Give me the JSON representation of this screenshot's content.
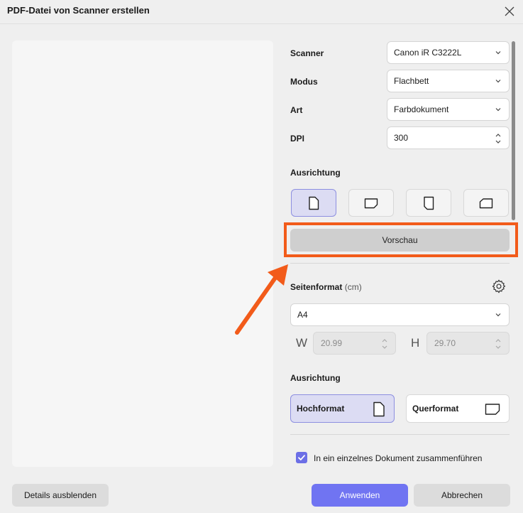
{
  "window": {
    "title": "PDF-Datei von Scanner erstellen"
  },
  "settings": {
    "scanner_label": "Scanner",
    "scanner_value": "Canon iR C3222L",
    "mode_label": "Modus",
    "mode_value": "Flachbett",
    "type_label": "Art",
    "type_value": "Farbdokument",
    "dpi_label": "DPI",
    "dpi_value": "300",
    "orientation_label": "Ausrichtung",
    "preview_label": "Vorschau"
  },
  "page_format": {
    "label": "Seitenformat",
    "unit": "(cm)",
    "size_value": "A4",
    "width_letter": "W",
    "width_value": "20.99",
    "height_letter": "H",
    "height_value": "29.70",
    "orientation_label": "Ausrichtung",
    "portrait_label": "Hochformat",
    "landscape_label": "Querformat"
  },
  "merge": {
    "label": "In ein einzelnes Dokument zusammenführen",
    "checked": true
  },
  "buttons": {
    "details": "Details ausblenden",
    "apply": "Anwenden",
    "cancel": "Abbrechen"
  },
  "colors": {
    "accent": "#7074f2",
    "highlight": "#f25b1a"
  }
}
